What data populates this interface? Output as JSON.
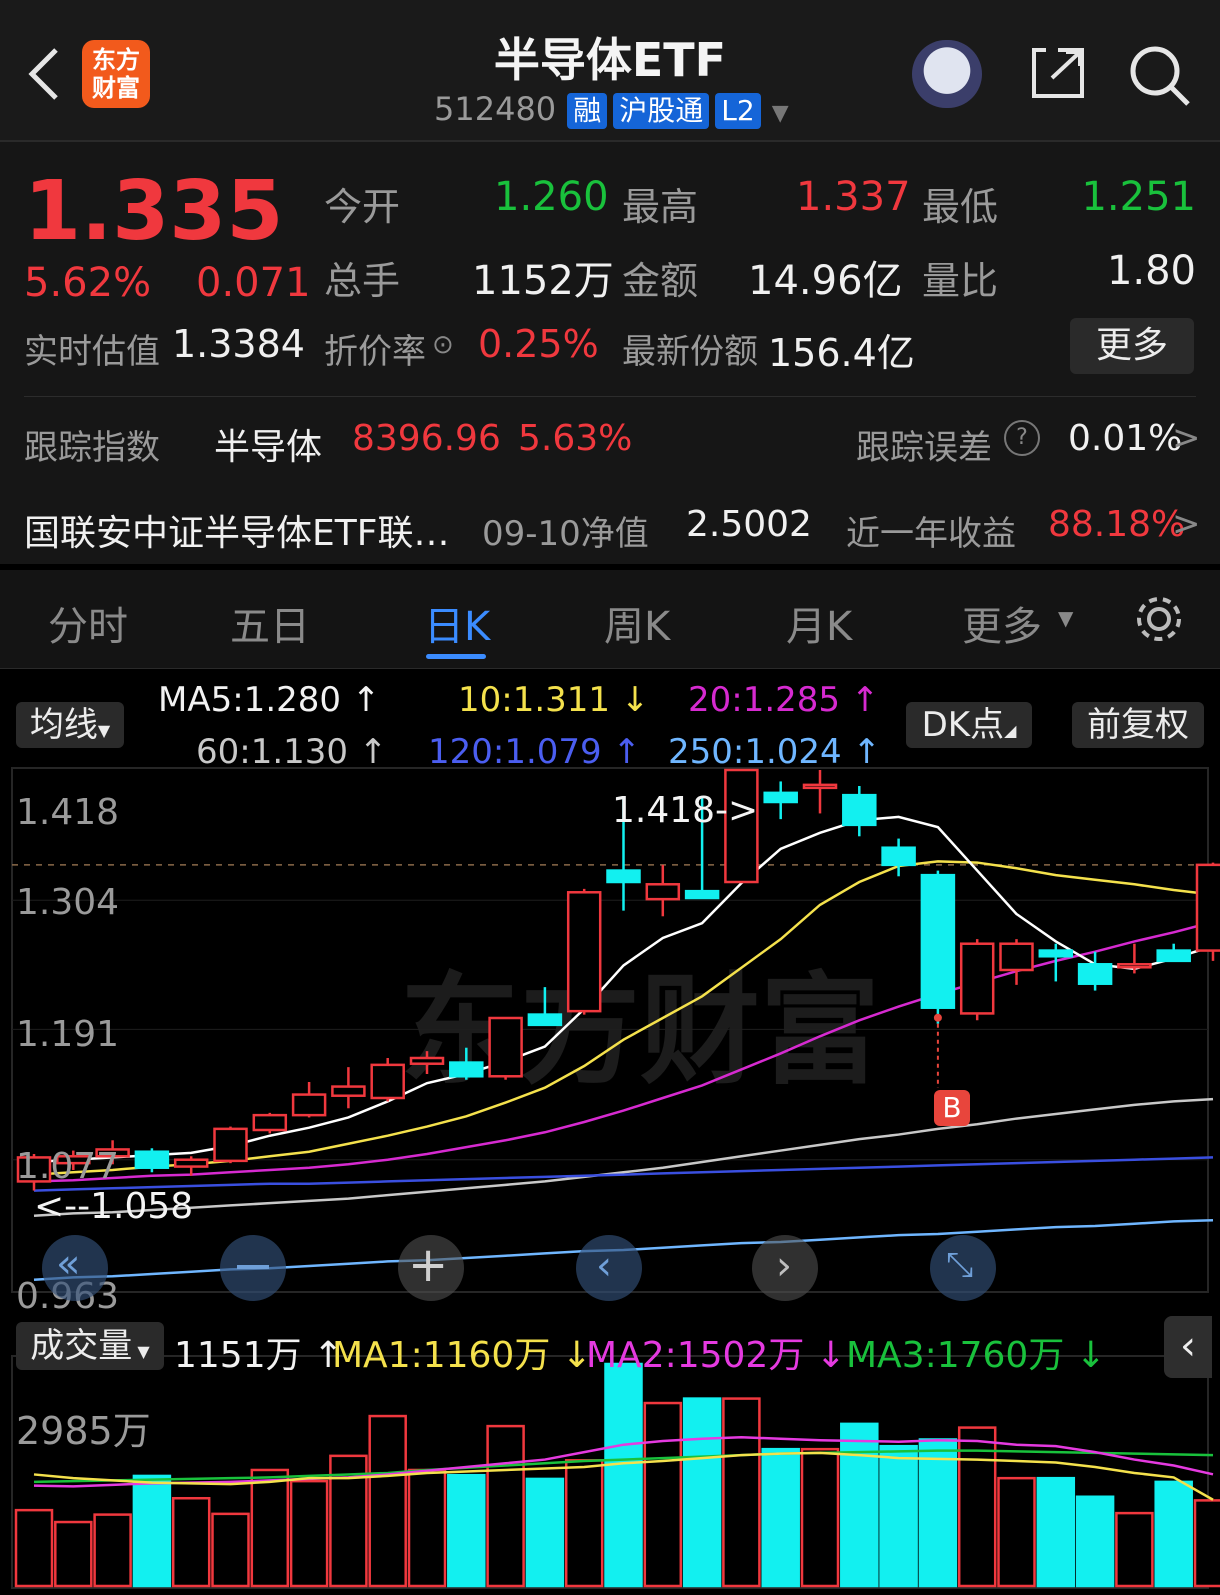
{
  "header": {
    "title": "半导体ETF",
    "code": "512480",
    "badges": [
      "融",
      "沪股通",
      "L2"
    ],
    "logo_text": "东方\n财富"
  },
  "quote": {
    "price": "1.335",
    "change_pct": "5.62%",
    "change": "0.071",
    "open_label": "今开",
    "open": "1.260",
    "high_label": "最高",
    "high": "1.337",
    "low_label": "最低",
    "low": "1.251",
    "vol_label": "总手",
    "vol": "1152万",
    "amt_label": "金额",
    "amt": "14.96亿",
    "ratio_label": "量比",
    "ratio": "1.80",
    "est_label": "实时估值",
    "est": "1.3384",
    "disc_label": "折价率",
    "disc": "0.25%",
    "share_label": "最新份额",
    "share": "156.4亿",
    "more": "更多"
  },
  "tracking": {
    "label": "跟踪指数",
    "index": "半导体",
    "value": "8396.96",
    "pct": "5.63%",
    "err_label": "跟踪误差",
    "err": "0.01%"
  },
  "fund": {
    "name": "国联安中证半导体ETF联…",
    "nav_label": "09-10净值",
    "nav": "2.5002",
    "ret_label": "近一年收益",
    "ret": "88.18%"
  },
  "tabs": [
    "分时",
    "五日",
    "日K",
    "周K",
    "月K",
    "更多"
  ],
  "ma": {
    "selector": "均线",
    "ma5": "MA5:1.280",
    "ma10": "10:1.311",
    "ma20": "20:1.285",
    "ma60": "60:1.130",
    "ma120": "120:1.079",
    "ma250": "250:1.024",
    "dk": "DK点",
    "fq": "前复权"
  },
  "kline": {
    "y_ticks": [
      "1.418",
      "1.304",
      "1.191",
      "1.077",
      "0.963"
    ],
    "max_label": "1.418->",
    "min_label": "<--1.058",
    "b_marker": "B"
  },
  "volume": {
    "selector": "成交量",
    "vol": "1151万",
    "ma1": "MA1:1160万",
    "ma2": "MA2:1502万",
    "ma3": "MA3:1760万",
    "y_tick": "2985万"
  },
  "colors": {
    "up": "#f0383e",
    "down": "#12f0f0",
    "ma5": "#ffffff",
    "ma10": "#f4e14c",
    "ma20": "#d62ad0",
    "ma60": "#c8c8c8",
    "ma120": "#3a4fe0",
    "ma250": "#6fb6ff"
  },
  "chart_data": {
    "type": "candlestick",
    "y_range": [
      0.963,
      1.418
    ],
    "candles": [
      {
        "o": 1.058,
        "h": 1.082,
        "l": 1.05,
        "c": 1.079
      },
      {
        "o": 1.074,
        "h": 1.085,
        "l": 1.068,
        "c": 1.08
      },
      {
        "o": 1.08,
        "h": 1.094,
        "l": 1.073,
        "c": 1.086
      },
      {
        "o": 1.084,
        "h": 1.087,
        "l": 1.066,
        "c": 1.07
      },
      {
        "o": 1.071,
        "h": 1.08,
        "l": 1.063,
        "c": 1.077
      },
      {
        "o": 1.076,
        "h": 1.106,
        "l": 1.074,
        "c": 1.104
      },
      {
        "o": 1.103,
        "h": 1.118,
        "l": 1.1,
        "c": 1.116
      },
      {
        "o": 1.116,
        "h": 1.145,
        "l": 1.114,
        "c": 1.134
      },
      {
        "o": 1.133,
        "h": 1.158,
        "l": 1.122,
        "c": 1.141
      },
      {
        "o": 1.131,
        "h": 1.166,
        "l": 1.128,
        "c": 1.16
      },
      {
        "o": 1.161,
        "h": 1.172,
        "l": 1.152,
        "c": 1.166
      },
      {
        "o": 1.162,
        "h": 1.175,
        "l": 1.147,
        "c": 1.15
      },
      {
        "o": 1.15,
        "h": 1.201,
        "l": 1.147,
        "c": 1.201
      },
      {
        "o": 1.204,
        "h": 1.228,
        "l": 1.195,
        "c": 1.195
      },
      {
        "o": 1.207,
        "h": 1.314,
        "l": 1.204,
        "c": 1.311
      },
      {
        "o": 1.33,
        "h": 1.395,
        "l": 1.295,
        "c": 1.32
      },
      {
        "o": 1.305,
        "h": 1.335,
        "l": 1.29,
        "c": 1.318
      },
      {
        "o": 1.312,
        "h": 1.394,
        "l": 1.306,
        "c": 1.306
      },
      {
        "o": 1.32,
        "h": 1.418,
        "l": 1.32,
        "c": 1.418
      },
      {
        "o": 1.398,
        "h": 1.408,
        "l": 1.375,
        "c": 1.39
      },
      {
        "o": 1.405,
        "h": 1.418,
        "l": 1.38,
        "c": 1.405
      },
      {
        "o": 1.396,
        "h": 1.404,
        "l": 1.36,
        "c": 1.37
      },
      {
        "o": 1.35,
        "h": 1.358,
        "l": 1.325,
        "c": 1.335
      },
      {
        "o": 1.326,
        "h": 1.33,
        "l": 1.196,
        "c": 1.21
      },
      {
        "o": 1.205,
        "h": 1.27,
        "l": 1.199,
        "c": 1.266
      },
      {
        "o": 1.243,
        "h": 1.27,
        "l": 1.23,
        "c": 1.266
      },
      {
        "o": 1.26,
        "h": 1.266,
        "l": 1.233,
        "c": 1.255
      },
      {
        "o": 1.248,
        "h": 1.259,
        "l": 1.225,
        "c": 1.231
      },
      {
        "o": 1.248,
        "h": 1.266,
        "l": 1.24,
        "c": 1.248
      },
      {
        "o": 1.26,
        "h": 1.266,
        "l": 1.251,
        "c": 1.251
      },
      {
        "o": 1.26,
        "h": 1.337,
        "l": 1.251,
        "c": 1.335
      }
    ],
    "ma5": [
      1.075,
      1.077,
      1.079,
      1.081,
      1.083,
      1.089,
      1.098,
      1.105,
      1.114,
      1.128,
      1.144,
      1.152,
      1.163,
      1.176,
      1.209,
      1.247,
      1.271,
      1.284,
      1.319,
      1.349,
      1.363,
      1.374,
      1.377,
      1.368,
      1.33,
      1.292,
      1.268,
      1.248,
      1.244,
      1.253,
      1.264
    ],
    "ma10": [
      1.064,
      1.066,
      1.068,
      1.071,
      1.073,
      1.076,
      1.08,
      1.084,
      1.091,
      1.098,
      1.106,
      1.115,
      1.127,
      1.14,
      1.159,
      1.182,
      1.201,
      1.22,
      1.245,
      1.27,
      1.3,
      1.32,
      1.334,
      1.338,
      1.337,
      1.332,
      1.326,
      1.322,
      1.318,
      1.313,
      1.309
    ],
    "ma20": [
      1.058,
      1.059,
      1.061,
      1.063,
      1.064,
      1.066,
      1.068,
      1.07,
      1.073,
      1.077,
      1.082,
      1.088,
      1.094,
      1.101,
      1.11,
      1.12,
      1.131,
      1.142,
      1.156,
      1.17,
      1.185,
      1.199,
      1.211,
      1.222,
      1.232,
      1.242,
      1.251,
      1.259,
      1.268,
      1.276,
      1.285
    ],
    "ma60": [
      1.028,
      1.03,
      1.031,
      1.033,
      1.035,
      1.037,
      1.039,
      1.041,
      1.043,
      1.046,
      1.049,
      1.052,
      1.055,
      1.058,
      1.062,
      1.066,
      1.07,
      1.075,
      1.08,
      1.085,
      1.09,
      1.095,
      1.099,
      1.104,
      1.108,
      1.113,
      1.117,
      1.121,
      1.125,
      1.128,
      1.13
    ],
    "ma120": [
      1.05,
      1.051,
      1.052,
      1.053,
      1.054,
      1.055,
      1.056,
      1.056,
      1.057,
      1.058,
      1.059,
      1.06,
      1.061,
      1.062,
      1.063,
      1.064,
      1.065,
      1.066,
      1.067,
      1.068,
      1.069,
      1.07,
      1.071,
      1.072,
      1.073,
      1.074,
      1.075,
      1.076,
      1.077,
      1.078,
      1.079
    ],
    "ma250": [
      0.972,
      0.974,
      0.975,
      0.977,
      0.979,
      0.981,
      0.982,
      0.984,
      0.986,
      0.988,
      0.989,
      0.991,
      0.993,
      0.995,
      0.997,
      0.998,
      1.0,
      1.002,
      1.004,
      1.005,
      1.007,
      1.009,
      1.011,
      1.012,
      1.014,
      1.016,
      1.018,
      1.019,
      1.021,
      1.023,
      1.024
    ],
    "volume_wan": [
      1020,
      860,
      960,
      1480,
      1180,
      970,
      1560,
      1410,
      1750,
      2285,
      1560,
      1490,
      2150,
      1440,
      1690,
      2985,
      2460,
      2520,
      2520,
      1840,
      1840,
      2180,
      1880,
      1970,
      2130,
      1450,
      1450,
      1200,
      980,
      1400,
      1151
    ],
    "vol_ma1": [
      1500,
      1450,
      1420,
      1390,
      1380,
      1370,
      1400,
      1450,
      1450,
      1480,
      1520,
      1540,
      1560,
      1580,
      1600,
      1650,
      1680,
      1720,
      1760,
      1780,
      1790,
      1760,
      1720,
      1710,
      1700,
      1680,
      1660,
      1600,
      1520,
      1460,
      1160
    ],
    "vol_ma2": [
      1350,
      1340,
      1360,
      1380,
      1390,
      1400,
      1420,
      1440,
      1460,
      1500,
      1550,
      1600,
      1650,
      1700,
      1800,
      1900,
      1950,
      1980,
      2000,
      1980,
      1960,
      1950,
      1940,
      1960,
      1950,
      1900,
      1880,
      1800,
      1700,
      1620,
      1502
    ],
    "vol_ma3": [
      1400,
      1410,
      1420,
      1430,
      1440,
      1450,
      1460,
      1480,
      1500,
      1520,
      1560,
      1590,
      1620,
      1650,
      1680,
      1700,
      1720,
      1740,
      1760,
      1780,
      1790,
      1800,
      1810,
      1820,
      1820,
      1810,
      1800,
      1790,
      1780,
      1770,
      1760
    ]
  }
}
